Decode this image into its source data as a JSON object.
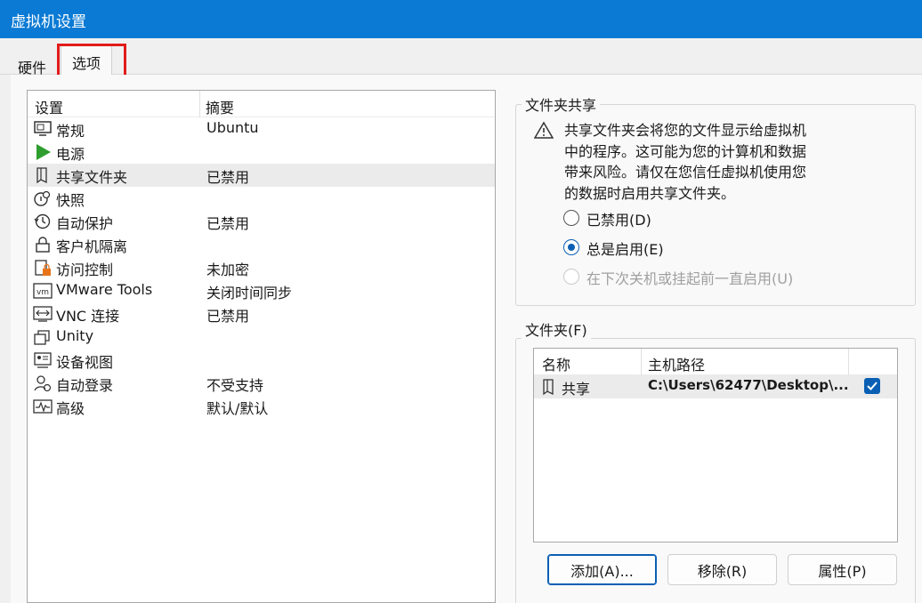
{
  "window": {
    "title": "虚拟机设置"
  },
  "tabs": [
    {
      "label": "硬件"
    },
    {
      "label": "选项"
    }
  ],
  "settings": {
    "header": {
      "col1": "设置",
      "col2": "摘要"
    },
    "rows": [
      {
        "label": "常规",
        "summary": "Ubuntu",
        "icon": "general-icon"
      },
      {
        "label": "电源",
        "summary": "",
        "icon": "power-play-icon"
      },
      {
        "label": "共享文件夹",
        "summary": "已禁用",
        "icon": "shared-folder-icon"
      },
      {
        "label": "快照",
        "summary": "",
        "icon": "snapshot-icon"
      },
      {
        "label": "自动保护",
        "summary": "已禁用",
        "icon": "autoprotect-clock-icon"
      },
      {
        "label": "客户机隔离",
        "summary": "",
        "icon": "lock-icon"
      },
      {
        "label": "访问控制",
        "summary": "未加密",
        "icon": "access-control-icon"
      },
      {
        "label": "VMware Tools",
        "summary": "关闭时间同步",
        "icon": "vmware-tools-icon"
      },
      {
        "label": "VNC 连接",
        "summary": "已禁用",
        "icon": "vnc-icon"
      },
      {
        "label": "Unity",
        "summary": "",
        "icon": "unity-icon"
      },
      {
        "label": "设备视图",
        "summary": "",
        "icon": "device-view-icon"
      },
      {
        "label": "自动登录",
        "summary": "不受支持",
        "icon": "autologin-user-icon"
      },
      {
        "label": "高级",
        "summary": "默认/默认",
        "icon": "advanced-pulse-icon"
      }
    ]
  },
  "sharing": {
    "title": "文件夹共享",
    "warning_lines": [
      "共享文件夹会将您的文件显示给虚拟机",
      "中的程序。这可能为您的计算机和数据",
      "带来风险。请仅在您信任虚拟机使用您",
      "的数据时启用共享文件夹。"
    ],
    "options": [
      {
        "label": "已禁用(D)",
        "state": "off"
      },
      {
        "label": "总是启用(E)",
        "state": "on"
      },
      {
        "label": "在下次关机或挂起前一直启用(U)",
        "state": "disabled"
      }
    ]
  },
  "folders": {
    "title": "文件夹(F)",
    "header": {
      "name": "名称",
      "path": "主机路径"
    },
    "rows": [
      {
        "name": "共享",
        "path": "C:\\Users\\62477\\Desktop\\...",
        "checked": true
      }
    ],
    "buttons": {
      "add": "添加(A)...",
      "remove": "移除(R)",
      "props": "属性(P)"
    }
  },
  "colors": {
    "titlebar": "#0a7ad4",
    "accent": "#0a5fb5",
    "highlight": "#e31b1b",
    "power": "#2e9e2e",
    "warning_lock": "#e8741a"
  }
}
